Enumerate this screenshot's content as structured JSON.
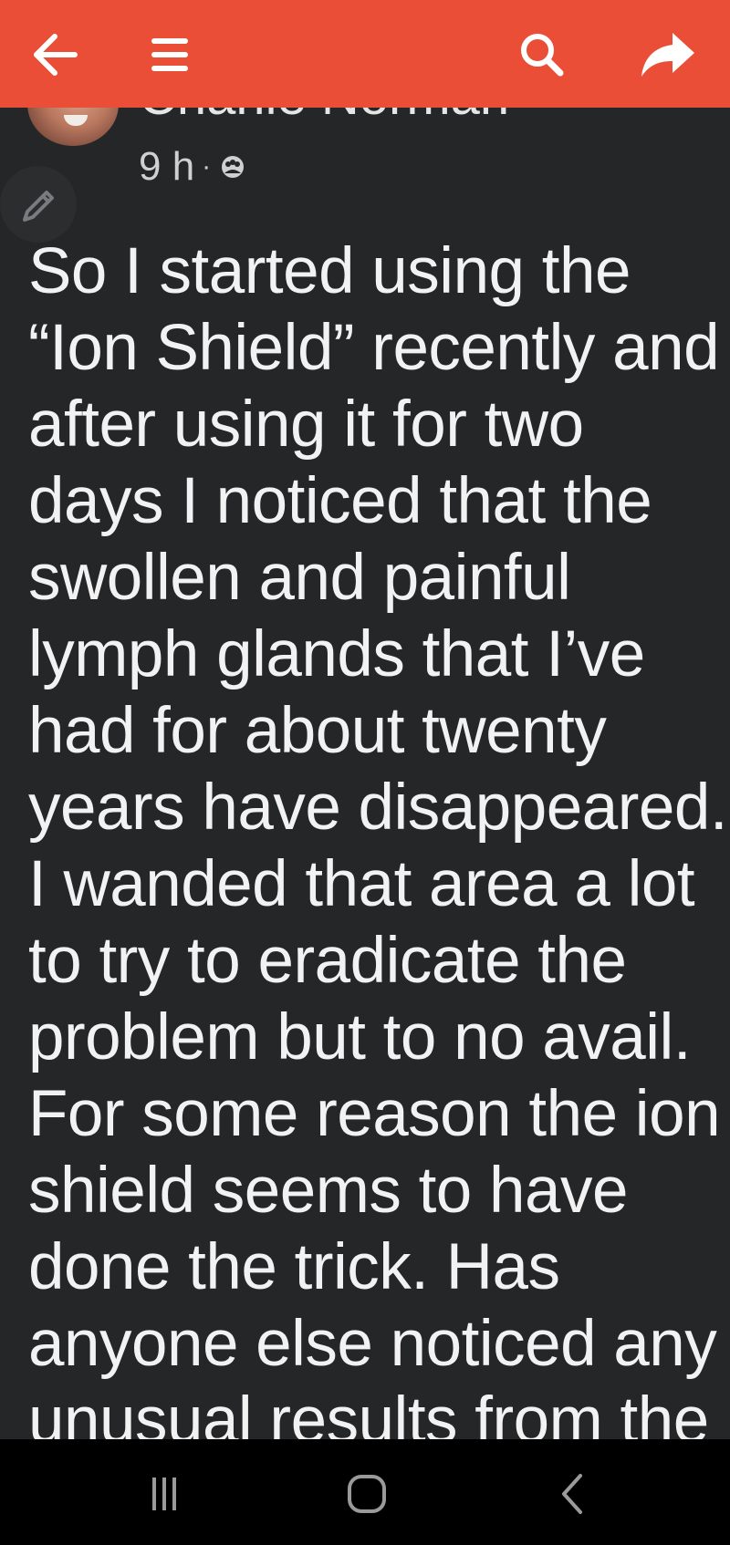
{
  "author": {
    "name": "Charlie Norman"
  },
  "post": {
    "time": "9 h",
    "separator": "·",
    "body_lines": [
      "So I started using the",
      "“Ion Shield” recently and",
      "after using it for two",
      "days I noticed that the",
      "swollen and painful",
      "lymph glands that I’ve",
      "had for about twenty",
      "years have disappeared.",
      "I wanded that area a lot",
      "to try to eradicate the",
      "problem but to no avail.",
      "For some reason the ion",
      "shield seems to have",
      "done the trick. Has",
      "anyone else noticed any",
      "unusual results from the"
    ]
  },
  "icons": {
    "back": "arrow-left-icon",
    "menu": "hamburger-menu-icon",
    "search": "search-icon",
    "share": "share-icon",
    "privacy": "group-privacy-icon",
    "edit": "pencil-icon",
    "nav_recents": "recents-icon",
    "nav_home": "home-icon",
    "nav_back": "back-chevron-icon"
  },
  "colors": {
    "topbar": "#ea4e36",
    "background": "#252628",
    "text": "#f2f2f2",
    "navbar": "#000000"
  }
}
